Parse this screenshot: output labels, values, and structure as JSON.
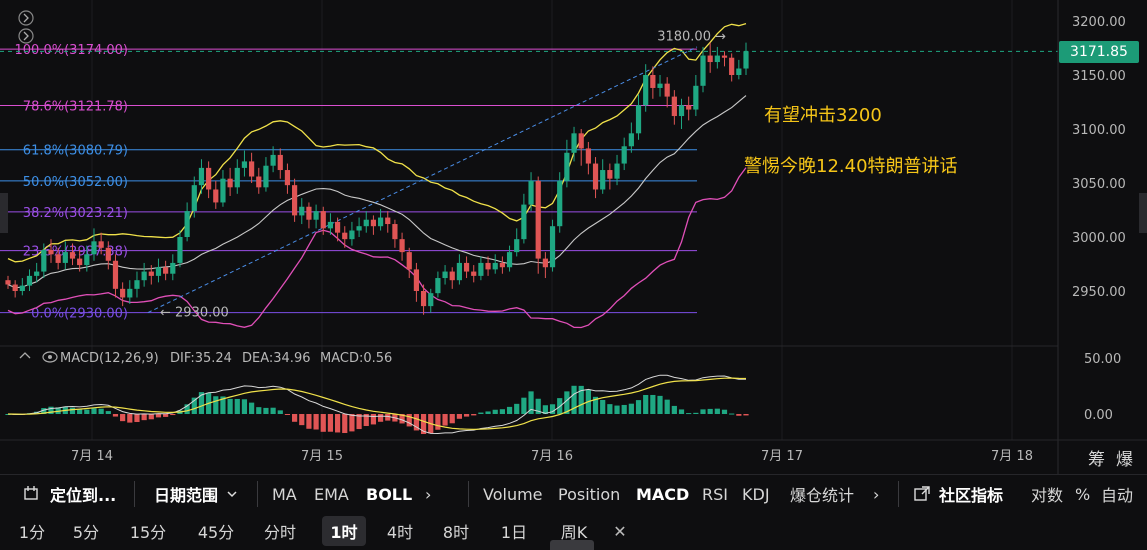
{
  "chart_data": {
    "type": "candlestick",
    "y_axis_ticks": [
      "3200.00",
      "3150.00",
      "3100.00",
      "3050.00",
      "3000.00",
      "2950.00"
    ],
    "ylim": [
      2910,
      3218
    ],
    "x_axis_ticks": [
      "7月 14",
      "7月 15",
      "7月 16",
      "7月 17",
      "7月 18"
    ],
    "current_price": "3171.85",
    "high_marker": "3180.00",
    "low_marker": "2930.00",
    "fib_levels": [
      {
        "label": "100.0%(3174.00)",
        "value": 3174.0,
        "color": "#d94fd0"
      },
      {
        "label": "78.6%(3121.78)",
        "value": 3121.78,
        "color": "#d94fd0"
      },
      {
        "label": "61.8%(3080.79)",
        "value": 3080.79,
        "color": "#3d8fe6"
      },
      {
        "label": "50.0%(3052.00)",
        "value": 3052.0,
        "color": "#3d8fe6"
      },
      {
        "label": "38.2%(3023.21)",
        "value": 3023.21,
        "color": "#9b4fe6"
      },
      {
        "label": "23.6%(2987.38)",
        "value": 2987.38,
        "color": "#9b4fe6"
      },
      {
        "label": "0.0%(2930.00)",
        "value": 2930.0,
        "color": "#7b4fe6"
      }
    ],
    "candles": [
      [
        2960,
        2956,
        2964,
        2952
      ],
      [
        2956,
        2950,
        2960,
        2944
      ],
      [
        2950,
        2955,
        2962,
        2946
      ],
      [
        2955,
        2964,
        2970,
        2950
      ],
      [
        2964,
        2968,
        2976,
        2958
      ],
      [
        2968,
        2988,
        2994,
        2962
      ],
      [
        2988,
        2984,
        2998,
        2976
      ],
      [
        2984,
        2976,
        2990,
        2970
      ],
      [
        2976,
        2986,
        2996,
        2970
      ],
      [
        2986,
        2980,
        2994,
        2974
      ],
      [
        2980,
        2974,
        2988,
        2968
      ],
      [
        2974,
        2984,
        2992,
        2968
      ],
      [
        2984,
        2996,
        3008,
        2978
      ],
      [
        2996,
        2990,
        3004,
        2984
      ],
      [
        2990,
        2978,
        2996,
        2970
      ],
      [
        2978,
        2952,
        2984,
        2944
      ],
      [
        2952,
        2944,
        2958,
        2936
      ],
      [
        2944,
        2952,
        2960,
        2938
      ],
      [
        2952,
        2960,
        2968,
        2944
      ],
      [
        2960,
        2968,
        2976,
        2954
      ],
      [
        2968,
        2964,
        2974,
        2956
      ],
      [
        2964,
        2972,
        2980,
        2958
      ],
      [
        2972,
        2966,
        2978,
        2960
      ],
      [
        2966,
        2976,
        2984,
        2960
      ],
      [
        2976,
        3000,
        3006,
        2972
      ],
      [
        3000,
        3024,
        3032,
        2996
      ],
      [
        3024,
        3048,
        3056,
        3018
      ],
      [
        3048,
        3064,
        3072,
        3040
      ],
      [
        3064,
        3044,
        3070,
        3036
      ],
      [
        3044,
        3032,
        3052,
        3026
      ],
      [
        3032,
        3054,
        3062,
        3028
      ],
      [
        3054,
        3046,
        3064,
        3038
      ],
      [
        3046,
        3064,
        3072,
        3040
      ],
      [
        3064,
        3070,
        3080,
        3056
      ],
      [
        3070,
        3056,
        3078,
        3050
      ],
      [
        3056,
        3046,
        3064,
        3040
      ],
      [
        3046,
        3066,
        3074,
        3042
      ],
      [
        3066,
        3076,
        3084,
        3060
      ],
      [
        3076,
        3062,
        3082,
        3054
      ],
      [
        3062,
        3048,
        3068,
        3040
      ],
      [
        3048,
        3020,
        3054,
        3014
      ],
      [
        3020,
        3028,
        3036,
        3012
      ],
      [
        3028,
        3016,
        3032,
        3008
      ],
      [
        3016,
        3024,
        3030,
        3008
      ],
      [
        3024,
        3008,
        3028,
        3002
      ],
      [
        3008,
        3014,
        3022,
        3002
      ],
      [
        3014,
        3004,
        3018,
        2996
      ],
      [
        3004,
        2998,
        3010,
        2990
      ],
      [
        2998,
        3006,
        3014,
        2992
      ],
      [
        3006,
        3010,
        3018,
        3000
      ],
      [
        3010,
        3016,
        3024,
        3004
      ],
      [
        3016,
        3010,
        3020,
        3002
      ],
      [
        3010,
        3018,
        3026,
        3006
      ],
      [
        3018,
        3012,
        3024,
        3004
      ],
      [
        3012,
        2998,
        3016,
        2990
      ],
      [
        2998,
        2986,
        3004,
        2978
      ],
      [
        2986,
        2970,
        2990,
        2962
      ],
      [
        2970,
        2950,
        2976,
        2940
      ],
      [
        2950,
        2936,
        2956,
        2928
      ],
      [
        2936,
        2948,
        2952,
        2930
      ],
      [
        2948,
        2962,
        2968,
        2944
      ],
      [
        2962,
        2968,
        2974,
        2956
      ],
      [
        2968,
        2960,
        2972,
        2952
      ],
      [
        2960,
        2976,
        2984,
        2956
      ],
      [
        2976,
        2968,
        2982,
        2962
      ],
      [
        2968,
        2964,
        2974,
        2958
      ],
      [
        2964,
        2976,
        2982,
        2960
      ],
      [
        2976,
        2970,
        2982,
        2964
      ],
      [
        2970,
        2976,
        2984,
        2966
      ],
      [
        2976,
        2972,
        2982,
        2966
      ],
      [
        2972,
        2986,
        2992,
        2968
      ],
      [
        2986,
        2998,
        3008,
        2982
      ],
      [
        2998,
        3030,
        3040,
        2994
      ],
      [
        3030,
        3052,
        3060,
        3024
      ],
      [
        3052,
        2980,
        3056,
        2966
      ],
      [
        2980,
        2972,
        2986,
        2962
      ],
      [
        2972,
        3010,
        3016,
        2968
      ],
      [
        3010,
        3052,
        3060,
        3004
      ],
      [
        3052,
        3078,
        3090,
        3046
      ],
      [
        3078,
        3096,
        3102,
        3070
      ],
      [
        3096,
        3082,
        3100,
        3066
      ],
      [
        3082,
        3068,
        3088,
        3058
      ],
      [
        3068,
        3044,
        3074,
        3036
      ],
      [
        3044,
        3062,
        3072,
        3040
      ],
      [
        3062,
        3054,
        3068,
        3044
      ],
      [
        3054,
        3068,
        3076,
        3048
      ],
      [
        3068,
        3084,
        3092,
        3062
      ],
      [
        3084,
        3096,
        3106,
        3078
      ],
      [
        3096,
        3122,
        3132,
        3090
      ],
      [
        3122,
        3150,
        3160,
        3116
      ],
      [
        3150,
        3138,
        3158,
        3128
      ],
      [
        3138,
        3142,
        3150,
        3130
      ],
      [
        3142,
        3130,
        3148,
        3120
      ],
      [
        3130,
        3112,
        3136,
        3104
      ],
      [
        3112,
        3122,
        3128,
        3100
      ],
      [
        3122,
        3118,
        3130,
        3108
      ],
      [
        3118,
        3140,
        3150,
        3112
      ],
      [
        3140,
        3168,
        3176,
        3134
      ],
      [
        3168,
        3162,
        3180,
        3152
      ],
      [
        3162,
        3168,
        3176,
        3156
      ],
      [
        3168,
        3166,
        3172,
        3158
      ],
      [
        3166,
        3150,
        3170,
        3144
      ],
      [
        3150,
        3156,
        3164,
        3146
      ],
      [
        3156,
        3172,
        3180,
        3150
      ]
    ]
  },
  "macd": {
    "label": "MACD(12,26,9)",
    "dif": "DIF:35.24",
    "dea": "DEA:34.96",
    "val": "MACD:0.56",
    "ticks": [
      "50.00",
      "0.00"
    ]
  },
  "annotations": {
    "line1": "有望冲击3200",
    "line2": "警惕今晚12.40特朗普讲话"
  },
  "corner": {
    "chip": "筹",
    "burst": "爆"
  },
  "toolbar": {
    "locate": "定位到...",
    "range": "日期范围",
    "ma": "MA",
    "ema": "EMA",
    "boll": "BOLL",
    "more1": "›",
    "volume": "Volume",
    "position": "Position",
    "macd": "MACD",
    "rsi": "RSI",
    "kdj": "KDJ",
    "liq": "爆仓统计",
    "more2": "›",
    "community": "社区指标",
    "log": "对数",
    "pct": "%",
    "auto": "自动"
  },
  "timeframes": [
    "1分",
    "5分",
    "15分",
    "45分",
    "分时",
    "1时",
    "4时",
    "8时",
    "1日",
    "周K"
  ],
  "active_timeframe": "1时",
  "close_icon_text": "✕"
}
